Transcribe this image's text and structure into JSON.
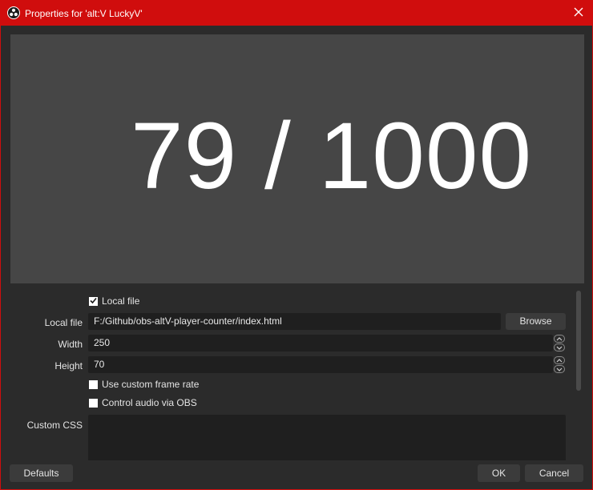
{
  "window": {
    "title": "Properties for 'alt:V LuckyV'",
    "app_icon": "obs-logo-icon",
    "close_icon": "close-icon",
    "accent_color": "#d00d0d"
  },
  "preview": {
    "text": "79 / 1000",
    "background": "#464646"
  },
  "properties": {
    "local_file_checkbox": {
      "label": "Local file",
      "checked": true
    },
    "local_file": {
      "label": "Local file",
      "value": "F:/Github/obs-altV-player-counter/index.html",
      "button": "Browse"
    },
    "width": {
      "label": "Width",
      "value": "250"
    },
    "height": {
      "label": "Height",
      "value": "70"
    },
    "custom_frame_rate": {
      "label": "Use custom frame rate",
      "checked": false
    },
    "control_audio": {
      "label": "Control audio via OBS",
      "checked": false
    },
    "custom_css": {
      "label": "Custom CSS",
      "value": ""
    }
  },
  "footer": {
    "defaults": "Defaults",
    "ok": "OK",
    "cancel": "Cancel"
  }
}
